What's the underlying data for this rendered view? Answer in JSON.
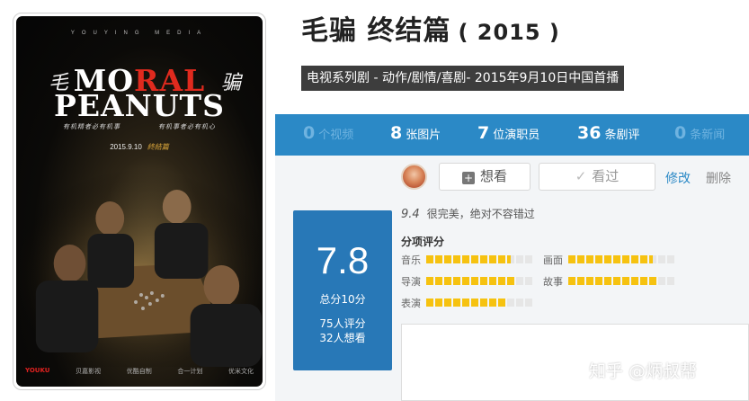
{
  "poster": {
    "media": "YOUYING MEDIA",
    "title_zh_left": "毛",
    "title_zh_right": "骗",
    "title_line1_a": "MO",
    "title_line1_b": "RAL",
    "title_line2": "PEANUTS",
    "tagline_left": "有机精者必有机事",
    "tagline_right": "有机事者必有机心",
    "date": "2015.9.10",
    "date_suffix": "終結篇",
    "logos": [
      "YOUKU",
      "贝嘉影视",
      "优酷自制",
      "合一计划",
      "优米文化"
    ]
  },
  "header": {
    "title": "毛骗 终结篇",
    "year": "( 2015 )",
    "genre_line": "电视系列剧 - 动作/剧情/喜剧- 2015年9月10日中国首播"
  },
  "stats": [
    {
      "num": "0",
      "label": "个视频",
      "dim": true
    },
    {
      "num": "8",
      "label": "张图片",
      "dim": false
    },
    {
      "num": "7",
      "label": "位演职员",
      "dim": false
    },
    {
      "num": "36",
      "label": "条剧评",
      "dim": false
    },
    {
      "num": "0",
      "label": "条新闻",
      "dim": true
    }
  ],
  "actions": {
    "want_label": "想看",
    "seen_label": "看过",
    "edit_label": "修改",
    "delete_label": "删除"
  },
  "score": {
    "value": "7.8",
    "total": "总分10分",
    "rating_count": "75人评分",
    "want_count": "32人想看"
  },
  "my_rating": {
    "value": "9.4",
    "comment": "很完美，绝对不容错过"
  },
  "sub_scores_title": "分项评分",
  "sub_scores": [
    {
      "label": "音乐",
      "filled": 9.5
    },
    {
      "label": "画面",
      "filled": 9.5
    },
    {
      "label": "导演",
      "filled": 10
    },
    {
      "label": "故事",
      "filled": 10
    },
    {
      "label": "表演",
      "filled": 9
    }
  ],
  "colors": {
    "stats_bar": "#2b89c6",
    "score_box": "#2878b7",
    "star_fill": "#f6c210",
    "badge_bg": "#3d3d3d"
  },
  "watermark": "知乎 @炳叔帮"
}
